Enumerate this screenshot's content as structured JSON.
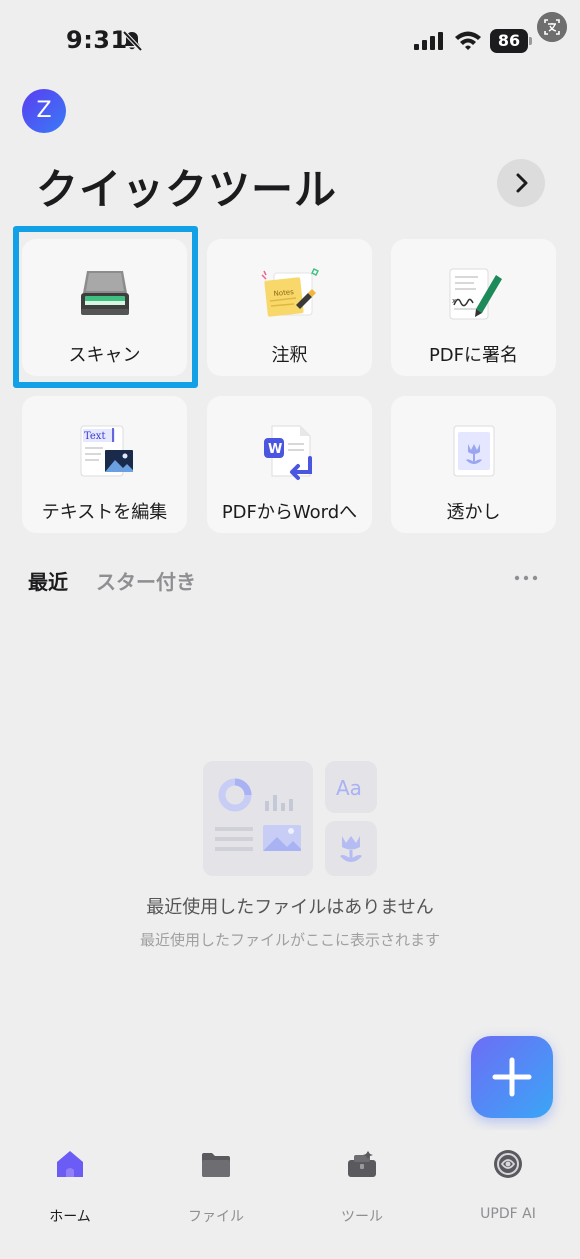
{
  "status_bar": {
    "time": "9:31",
    "battery": "86",
    "icons": [
      "bell-slash-icon",
      "cellular-signal-icon",
      "wifi-icon",
      "battery-icon",
      "translate-icon"
    ]
  },
  "header": {
    "avatar_initial": "Z",
    "title": "クイックツール",
    "arrow_icon": "chevron-right-icon"
  },
  "tools": [
    {
      "label": "スキャン",
      "icon": "scanner-icon",
      "highlighted": true
    },
    {
      "label": "注釈",
      "icon": "sticky-note-icon"
    },
    {
      "label": "PDFに署名",
      "icon": "signature-pen-icon"
    },
    {
      "label": "テキストを編集",
      "icon": "edit-text-icon"
    },
    {
      "label": "PDFからWordへ",
      "icon": "pdf-to-word-icon"
    },
    {
      "label": "透かし",
      "icon": "watermark-icon"
    }
  ],
  "tabs": [
    {
      "label": "最近",
      "active": true
    },
    {
      "label": "スター付き",
      "active": false
    }
  ],
  "empty_state": {
    "illustration_text": "Aa",
    "title": "最近使用したファイルはありません",
    "subtitle": "最近使用したファイルがここに表示されます"
  },
  "fab_icon": "plus-icon",
  "bottom_nav": [
    {
      "label": "ホーム",
      "icon": "home-icon",
      "active": true
    },
    {
      "label": "ファイル",
      "icon": "folder-icon",
      "active": false
    },
    {
      "label": "ツール",
      "icon": "toolbox-icon",
      "active": false
    },
    {
      "label": "UPDF AI",
      "icon": "ai-icon",
      "active": false
    }
  ],
  "colors": {
    "accent": "#12a1e6",
    "background": "#eeeeee",
    "card": "#f7f7f7",
    "fab_start": "#6d6df5",
    "fab_end": "#3aa6f6",
    "nav_active": "#6b5cf6"
  }
}
